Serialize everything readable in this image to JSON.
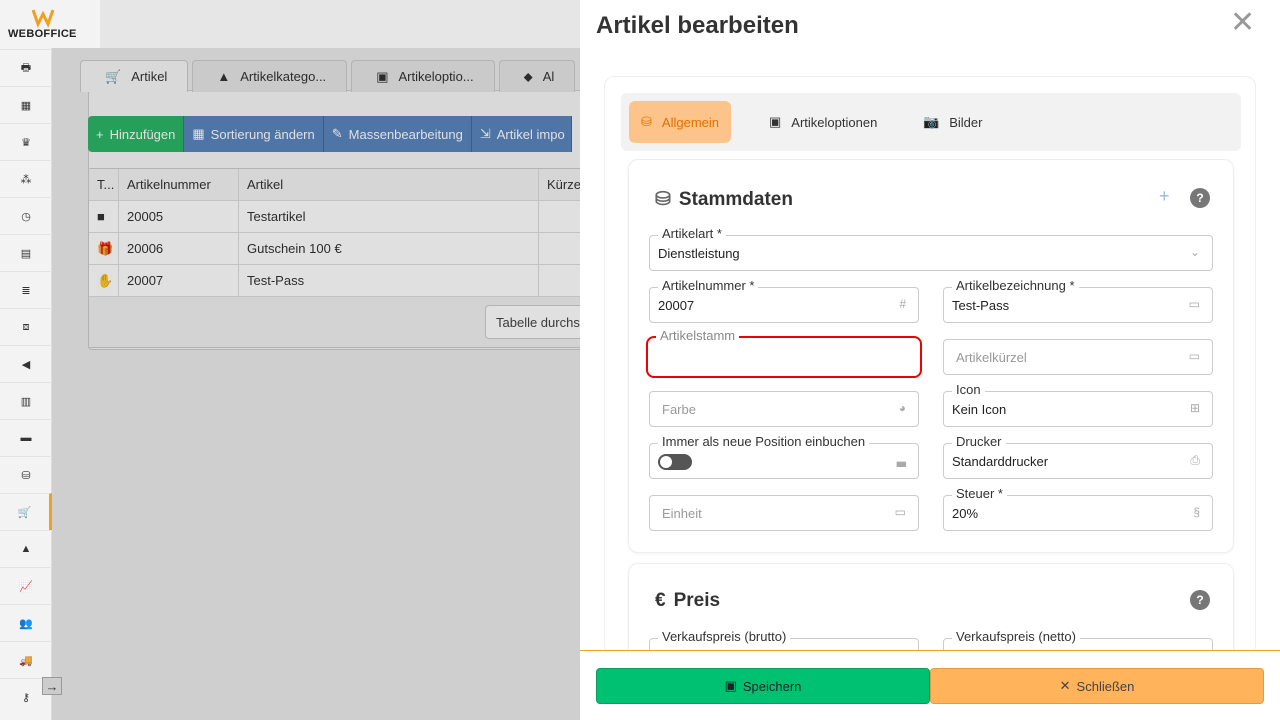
{
  "app": {
    "brand": "WEBOFFICE"
  },
  "sidebar": {
    "icons": [
      "register-icon",
      "calendar-icon",
      "crown-icon",
      "network-icon",
      "clock-icon",
      "document-icon",
      "list-icon",
      "cubes-icon",
      "megaphone-icon",
      "chart-icon",
      "folder-icon",
      "database-icon",
      "cart-icon",
      "warehouse-icon",
      "stats-icon",
      "users-icon",
      "truck-icon",
      "key-icon"
    ],
    "active": "cart-icon"
  },
  "tabs": [
    {
      "label": "Artikel",
      "icon": "cart-icon"
    },
    {
      "label": "Artikelkatego...",
      "icon": "shapes-icon"
    },
    {
      "label": "Artikeloptio...",
      "icon": "options-icon"
    },
    {
      "label": "Al",
      "icon": "tag-icon"
    }
  ],
  "toolbar": {
    "add": "Hinzufügen",
    "sort": "Sortierung ändern",
    "mass": "Massenbearbeitung",
    "import": "Artikel impo"
  },
  "table": {
    "headers": [
      "T...",
      "Artikelnummer",
      "Artikel",
      "Kürze"
    ],
    "rows": [
      {
        "icon": "briefcase-icon",
        "number": "20005",
        "name": "Testartikel"
      },
      {
        "icon": "gift-icon",
        "number": "20006",
        "name": "Gutschein 100 €"
      },
      {
        "icon": "hand-icon",
        "number": "20007",
        "name": "Test-Pass"
      }
    ],
    "summary_button": "Tabelle durchs"
  },
  "drawer": {
    "title": "Artikel bearbeiten",
    "subtabs": [
      {
        "label": "Allgemein",
        "active": true
      },
      {
        "label": "Artikeloptionen",
        "active": false
      },
      {
        "label": "Bilder",
        "active": false
      }
    ],
    "stammdaten": {
      "title": "Stammdaten",
      "help": "?",
      "fields": {
        "artikelart": {
          "label": "Artikelart *",
          "value": "Dienstleistung"
        },
        "artikelnummer": {
          "label": "Artikelnummer *",
          "value": "20007"
        },
        "artikelbezeichnung": {
          "label": "Artikelbezeichnung *",
          "value": "Test-Pass"
        },
        "artikelstamm": {
          "label": "Artikelstamm",
          "value": ""
        },
        "artikelkuerzel": {
          "placeholder": "Artikelkürzel"
        },
        "farbe": {
          "placeholder": "Farbe"
        },
        "icon": {
          "label": "Icon",
          "value": "Kein Icon"
        },
        "position": {
          "label": "Immer als neue Position einbuchen",
          "checked": false
        },
        "drucker": {
          "label": "Drucker",
          "value": "Standarddrucker"
        },
        "einheit": {
          "placeholder": "Einheit"
        },
        "steuer": {
          "label": "Steuer *",
          "value": "20%"
        }
      }
    },
    "preis": {
      "title": "Preis",
      "help": "?",
      "brutto_label": "Verkaufspreis (brutto)",
      "netto_label": "Verkaufspreis (netto)"
    },
    "footer": {
      "save": "Speichern",
      "close": "Schließen"
    }
  }
}
